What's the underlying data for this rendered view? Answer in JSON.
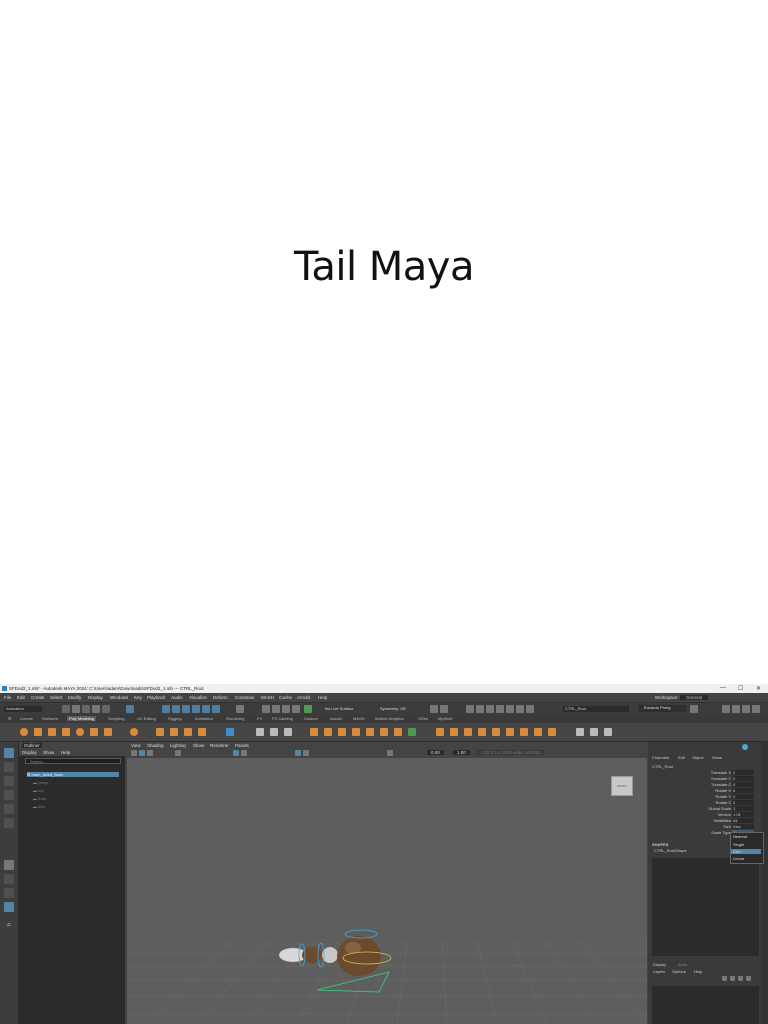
{
  "slide": {
    "title": "Tail Maya"
  },
  "window": {
    "title": "SFDod2_1.mb* - Autodesk MAYA 2024: C:\\Users\\adam\\Downloads\\SFDod2_1.mb  ---  CTRL_Root",
    "controls": [
      "—",
      "☐",
      "✕"
    ]
  },
  "menu": {
    "items": [
      "File",
      "Edit",
      "Create",
      "Select",
      "Modify",
      "Display",
      "Windows",
      "Key",
      "Playback",
      "Audio",
      "Visualize",
      "Deform",
      "Constrain",
      "MASH",
      "Cache",
      "Arnold",
      "Help"
    ],
    "workspace_label": "Workspace:",
    "workspace_value": "General"
  },
  "status": {
    "mode": "Animation",
    "live_surface": "No Live Surface",
    "symmetry": "Symmetry: Off",
    "object_field": "CTRL_Root",
    "user": "Eduardo Pineg"
  },
  "shelf": {
    "tabs": [
      "Curves",
      "Surfaces",
      "Poly Modeling",
      "Sculpting",
      "UV Editing",
      "Rigging",
      "Animation",
      "Rendering",
      "FX",
      "FX Caching",
      "Custom",
      "Arnold",
      "MASH",
      "Motion Graphics",
      "XGen",
      "MyShelf"
    ],
    "active_tab": "Poly Modeling"
  },
  "outliner": {
    "title": "Outliner",
    "menu": [
      "Display",
      "Show",
      "Help"
    ],
    "search_placeholder": "Search...",
    "items": [
      "trash_tailed_flash",
      "persp",
      "top",
      "front",
      "side"
    ]
  },
  "viewport": {
    "menu": [
      "View",
      "Shading",
      "Lighting",
      "Show",
      "Renderer",
      "Panels"
    ],
    "field_a": "0.00",
    "field_b": "1.00",
    "colorspace": "ACES 1.0 SDR-video (sRGB)",
    "viewcube_label": "FRONT"
  },
  "channel_box": {
    "menu": [
      "Channels",
      "Edit",
      "Object",
      "Show"
    ],
    "object": "CTRL_Root",
    "attrs": [
      {
        "name": "Translate X",
        "value": "0"
      },
      {
        "name": "Translate Y",
        "value": "0"
      },
      {
        "name": "Translate Z",
        "value": "0"
      },
      {
        "name": "Rotate X",
        "value": "0"
      },
      {
        "name": "Rotate Y",
        "value": "0"
      },
      {
        "name": "Rotate Z",
        "value": "0"
      },
      {
        "name": "Global Scale",
        "value": "1"
      },
      {
        "name": "Version",
        "value": "1.01"
      },
      {
        "name": "Visibilities",
        "value": "All"
      },
      {
        "name": "Size",
        "value": "Disc"
      },
      {
        "name": "Scale Type",
        "value": "Nearest"
      }
    ],
    "dropdown_options": [
      "Nearest",
      "Single",
      "Disc",
      "Linear"
    ],
    "dropdown_selected": "Disc",
    "shapes_label": "SHAPES",
    "shape_name": "CTRL_RootShape",
    "layer_tabs": [
      "Display",
      "Anim"
    ],
    "layer_menu": [
      "Layers",
      "Options",
      "Help"
    ]
  },
  "colors": {
    "panel": "#444444",
    "dark": "#2b2b2b",
    "viewport": "#5e5e5e",
    "accent": "#5285a6",
    "creature": "#6b4a2e"
  }
}
